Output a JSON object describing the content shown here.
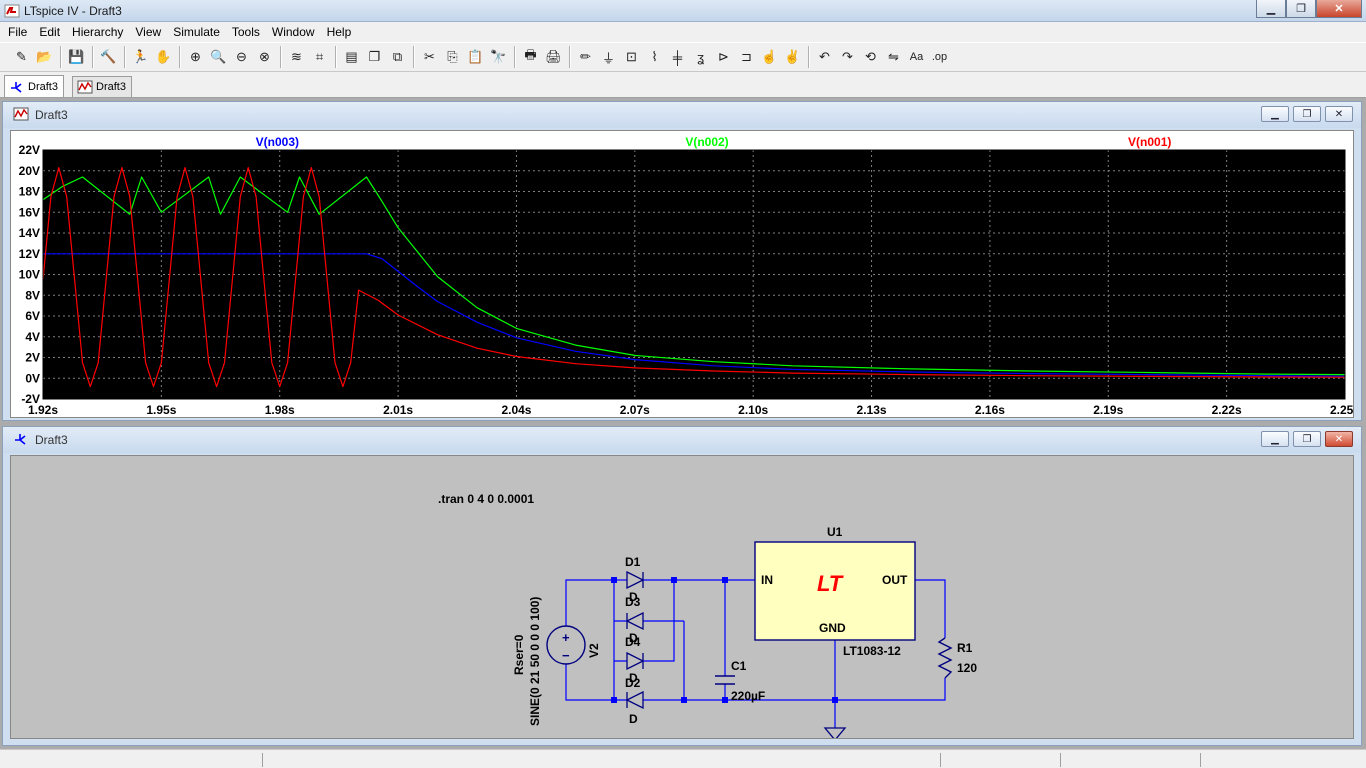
{
  "window": {
    "title": "LTspice IV - Draft3",
    "min": "▁",
    "max": "❐",
    "close": "✕"
  },
  "menu": [
    "File",
    "Edit",
    "Hierarchy",
    "View",
    "Simulate",
    "Tools",
    "Window",
    "Help"
  ],
  "toolbar": {
    "icons": [
      "new-schematic-icon",
      "open-icon",
      "save-icon",
      "control-panel-icon",
      "run-icon",
      "halt-icon",
      "zoom-in-icon",
      "zoom-pan-icon",
      "zoom-out-icon",
      "zoom-fit-icon",
      "autorange-icon",
      "marker-icon",
      "tile-horizontal-icon",
      "cascade-icon",
      "close-all-icon",
      "cut-icon",
      "copy-icon",
      "paste-icon",
      "find-icon",
      "print-setup-icon",
      "print-icon",
      "wire-icon",
      "ground-icon",
      "label-net-icon",
      "resistor-icon",
      "capacitor-icon",
      "inductor-icon",
      "diode-icon",
      "component-icon",
      "move-icon",
      "drag-icon",
      "undo-icon",
      "redo-icon",
      "rotate-icon",
      "mirror-icon",
      "text-icon",
      "spice-directive-icon"
    ],
    "glyphs": [
      "✎",
      "📂",
      "💾",
      "🔨",
      "🏃",
      "✋",
      "⊕",
      "🔍",
      "⊖",
      "⊗",
      "≋",
      "⌗",
      "▤",
      "❐",
      "⧉",
      "✂",
      "⎘",
      "📋",
      "🔭",
      "🖶",
      "🖨",
      "✏",
      "⏚",
      "⊡",
      "⌇",
      "╪",
      "ʓ",
      "⊳",
      "⊐",
      "☝",
      "✌",
      "↶",
      "↷",
      "⟲",
      "⇋",
      "Aa",
      ".op"
    ]
  },
  "tabs": [
    {
      "label": "Draft3",
      "kind": "schematic"
    },
    {
      "label": "Draft3",
      "kind": "waveform"
    }
  ],
  "plot_window": {
    "title": "Draft3"
  },
  "schematic_window": {
    "title": "Draft3"
  },
  "chart_data": {
    "type": "line",
    "xlabel": "",
    "ylabel": "",
    "xlim": [
      1.92,
      2.25
    ],
    "ylim": [
      -2,
      22
    ],
    "x_ticks": [
      1.92,
      1.95,
      1.98,
      2.01,
      2.04,
      2.07,
      2.1,
      2.13,
      2.16,
      2.19,
      2.22,
      2.25
    ],
    "x_tick_labels": [
      "1.92s",
      "1.95s",
      "1.98s",
      "2.01s",
      "2.04s",
      "2.07s",
      "2.10s",
      "2.13s",
      "2.16s",
      "2.19s",
      "2.22s",
      "2.25s"
    ],
    "y_ticks": [
      -2,
      0,
      2,
      4,
      6,
      8,
      10,
      12,
      14,
      16,
      18,
      20,
      22
    ],
    "y_tick_labels": [
      "-2V",
      "0V",
      "2V",
      "4V",
      "6V",
      "8V",
      "10V",
      "12V",
      "14V",
      "16V",
      "18V",
      "20V",
      "22V"
    ],
    "grid": true,
    "background": "#000000",
    "series": [
      {
        "name": "V(n003)",
        "color": "#0000ff",
        "x": [
          1.92,
          1.924,
          2.002,
          2.006,
          2.01,
          2.015,
          2.02,
          2.03,
          2.04,
          2.055,
          2.07,
          2.09,
          2.11,
          2.14,
          2.17,
          2.2,
          2.23,
          2.25
        ],
        "y": [
          12.0,
          12.0,
          12.0,
          11.5,
          10.3,
          8.8,
          7.4,
          5.4,
          3.9,
          2.6,
          1.8,
          1.2,
          0.85,
          0.6,
          0.45,
          0.35,
          0.25,
          0.2
        ]
      },
      {
        "name": "V(n002)",
        "color": "#00ff00",
        "x": [
          1.92,
          1.925,
          1.93,
          1.942,
          1.945,
          1.95,
          1.962,
          1.965,
          1.97,
          1.982,
          1.985,
          1.99,
          2.002,
          2.006,
          2.01,
          2.02,
          2.03,
          2.04,
          2.055,
          2.07,
          2.09,
          2.11,
          2.14,
          2.17,
          2.2,
          2.23,
          2.25
        ],
        "y": [
          17.2,
          18.5,
          19.4,
          15.8,
          19.4,
          16.0,
          19.4,
          15.8,
          19.4,
          16.0,
          19.4,
          15.8,
          19.4,
          17.0,
          14.5,
          9.8,
          6.8,
          4.8,
          3.2,
          2.2,
          1.6,
          1.2,
          0.9,
          0.7,
          0.55,
          0.4,
          0.35
        ]
      },
      {
        "name": "V(n001)",
        "color": "#ff0000",
        "x": [
          1.92,
          1.922,
          1.924,
          1.926,
          1.928,
          1.93,
          1.932,
          1.934,
          1.936,
          1.938,
          1.94,
          1.942,
          1.944,
          1.946,
          1.948,
          1.95,
          1.952,
          1.954,
          1.956,
          1.958,
          1.96,
          1.962,
          1.964,
          1.966,
          1.968,
          1.97,
          1.972,
          1.974,
          1.976,
          1.978,
          1.98,
          1.982,
          1.984,
          1.986,
          1.988,
          1.99,
          1.992,
          1.994,
          1.996,
          1.998,
          2.0,
          2.005,
          2.01,
          2.02,
          2.03,
          2.04,
          2.055,
          2.07,
          2.09,
          2.11,
          2.14,
          2.17,
          2.2,
          2.23,
          2.25
        ],
        "y": [
          9.5,
          17.5,
          20.3,
          17.5,
          9.5,
          1.5,
          -0.8,
          1.5,
          9.5,
          17.5,
          20.3,
          17.5,
          9.5,
          1.5,
          -0.8,
          1.5,
          9.5,
          17.5,
          20.3,
          17.5,
          9.5,
          1.5,
          -0.8,
          1.5,
          9.5,
          17.5,
          20.3,
          17.5,
          9.5,
          1.5,
          -0.8,
          1.5,
          9.5,
          17.5,
          20.3,
          17.5,
          9.5,
          1.5,
          -0.8,
          1.5,
          8.5,
          7.5,
          6.1,
          4.2,
          2.9,
          2.1,
          1.4,
          1.0,
          0.7,
          0.5,
          0.35,
          0.25,
          0.18,
          0.12,
          0.1
        ]
      }
    ]
  },
  "schematic": {
    "directive": ".tran 0 4 0 0.0001",
    "u1": {
      "ref": "U1",
      "model": "LT1083-12",
      "pin_in": "IN",
      "pin_out": "OUT",
      "pin_gnd": "GND",
      "logo": "LT"
    },
    "d1": {
      "ref": "D1",
      "model": "D"
    },
    "d2": {
      "ref": "D2",
      "model": "D"
    },
    "d3": {
      "ref": "D3",
      "model": "D"
    },
    "d4": {
      "ref": "D4",
      "model": "D"
    },
    "c1": {
      "ref": "C1",
      "value": "220µF"
    },
    "r1": {
      "ref": "R1",
      "value": "120"
    },
    "v2": {
      "ref": "V2",
      "value": "SINE(0 21 50 0 0 0 100)",
      "param": "Rser=0",
      "plus": "+",
      "minus": "−"
    },
    "colors": {
      "wire": "#0000ff",
      "component": "#000080",
      "body": "#ffffc0",
      "logo": "#ff0000"
    }
  }
}
